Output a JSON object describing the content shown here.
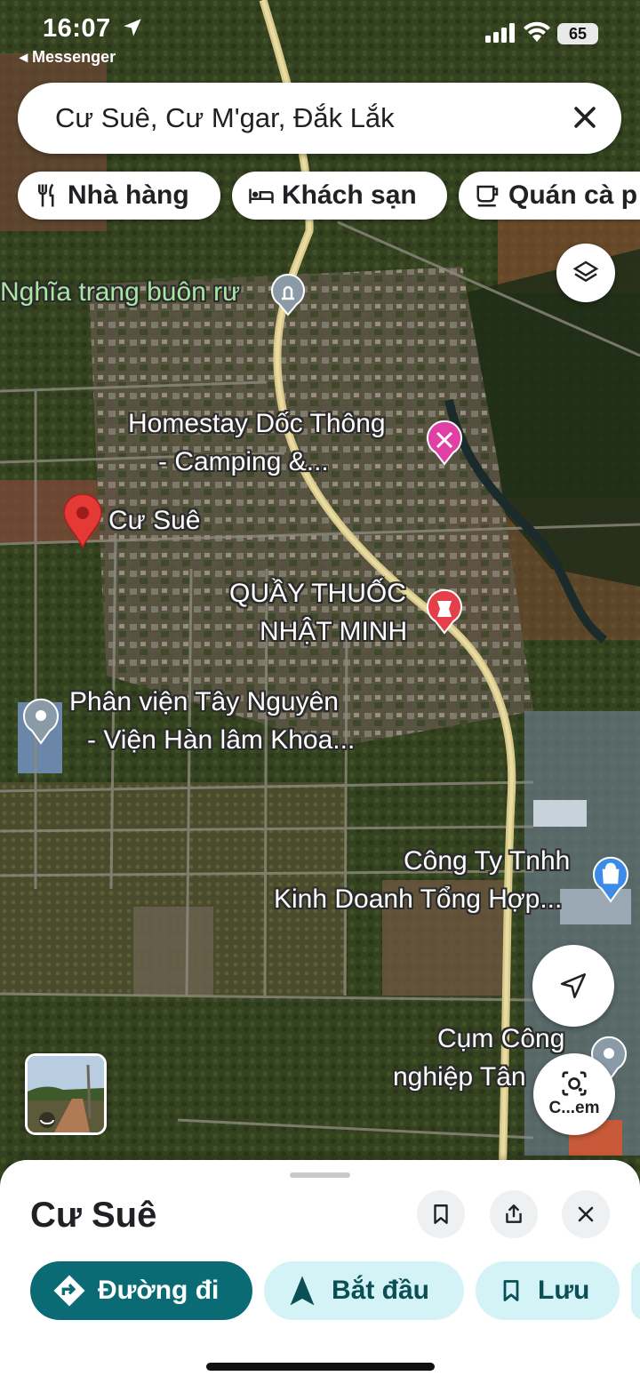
{
  "status_bar": {
    "time": "16:07",
    "back_app": "◂ Messenger",
    "battery": "65"
  },
  "search": {
    "query": "Cư Suê, Cư M'gar, Đắk Lắk"
  },
  "chips": [
    {
      "label": "Nhà hàng",
      "icon": "restaurant-icon"
    },
    {
      "label": "Khách sạn",
      "icon": "hotel-bed-icon"
    },
    {
      "label": "Quán cà p",
      "icon": "coffee-cup-icon"
    }
  ],
  "map_labels": {
    "cemetery": "Nghĩa trang buôn rư",
    "homestay_line1": "Homestay Dốc Thông",
    "homestay_line2": "- Camping &...",
    "selected_place": "Cư Suê",
    "pharmacy_line1": "QUẦY THUỐC",
    "pharmacy_line2": "NHẬT MINH",
    "institute_line1": "Phân viện Tây Nguyên",
    "institute_line2": "- Viện Hàn lâm Khoa...",
    "company_line1": "Công Ty Tnhh",
    "company_line2": "Kinh Doanh Tổng Hợp...",
    "industrial_line1": "Cụm Công",
    "industrial_line2": "nghiệp Tân",
    "lens_label": "C...em"
  },
  "place_sheet": {
    "title": "Cư Suê",
    "actions": {
      "directions": "Đường đi",
      "start": "Bắt đầu",
      "save": "Lưu"
    }
  },
  "colors": {
    "primary_action": "#0b6b75",
    "secondary_action": "#d4f3f6",
    "pin_red": "#e53935",
    "homestay_pink": "#e03fa5",
    "company_blue": "#3d8be8"
  }
}
